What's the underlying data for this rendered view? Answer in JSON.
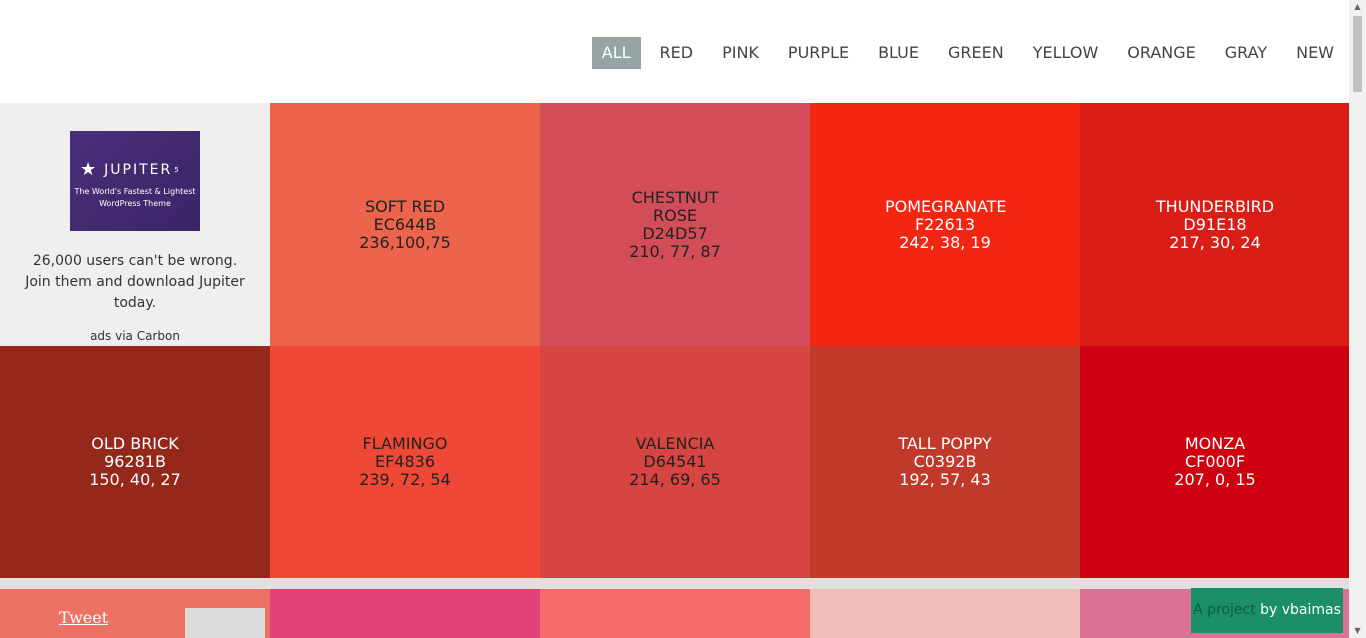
{
  "nav": {
    "items": [
      "ALL",
      "RED",
      "PINK",
      "PURPLE",
      "BLUE",
      "GREEN",
      "YELLOW",
      "ORANGE",
      "GRAY",
      "NEW"
    ],
    "active": "ALL"
  },
  "ad": {
    "logo_text": "JUPITER",
    "logo_sup": "5",
    "tagline_1": "The World's Fastest & Lightest",
    "tagline_2": "WordPress Theme",
    "copy": "26,000 users can't be wrong. Join them and download Jupiter today.",
    "via": "ads via Carbon"
  },
  "colors": [
    {
      "name": "SOFT RED",
      "hex": "EC644B",
      "rgb": "236,100,75",
      "bg": "#EC644B",
      "text": "#222222"
    },
    {
      "name": "CHESTNUT ROSE",
      "hex": "D24D57",
      "rgb": "210, 77, 87",
      "bg": "#D24D57",
      "text": "#222222"
    },
    {
      "name": "POMEGRANATE",
      "hex": "F22613",
      "rgb": "242, 38, 19",
      "bg": "#F22613",
      "text": "#ffffff"
    },
    {
      "name": "THUNDERBIRD",
      "hex": "D91E18",
      "rgb": "217, 30, 24",
      "bg": "#D91E18",
      "text": "#ffffff"
    },
    {
      "name": "OLD BRICK",
      "hex": "96281B",
      "rgb": "150, 40, 27",
      "bg": "#96281B",
      "text": "#ffffff"
    },
    {
      "name": "FLAMINGO",
      "hex": "EF4836",
      "rgb": "239, 72, 54",
      "bg": "#EF4836",
      "text": "#222222"
    },
    {
      "name": "VALENCIA",
      "hex": "D64541",
      "rgb": "214, 69, 65",
      "bg": "#D64541",
      "text": "#222222"
    },
    {
      "name": "TALL POPPY",
      "hex": "C0392B",
      "rgb": "192, 57, 43",
      "bg": "#C0392B",
      "text": "#ffffff"
    },
    {
      "name": "MONZA",
      "hex": "CF000F",
      "rgb": "207, 0, 15",
      "bg": "#CF000F",
      "text": "#ffffff"
    }
  ],
  "third_row": [
    {
      "bg": "#EC7263"
    },
    {
      "bg": "#E2427A"
    },
    {
      "bg": "#F56A6A"
    },
    {
      "bg": "#F2BCBA"
    },
    {
      "bg": "#DB7193"
    }
  ],
  "footer": {
    "tweet_label": "Tweet",
    "project_prefix": "A project",
    "project_author": " by vbaimas",
    "badge_color": "#1A8F6A"
  }
}
